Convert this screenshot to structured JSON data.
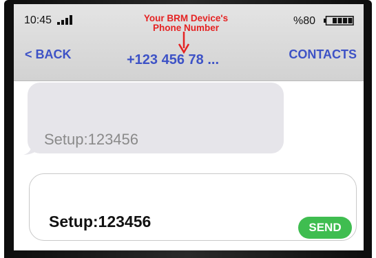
{
  "status_bar": {
    "time": "10:45",
    "battery_percent": "%80",
    "signal_icon": "signal-bars-icon",
    "battery_icon": "battery-icon"
  },
  "annotation": {
    "line1": "Your BRM Device's",
    "line2": "Phone Number",
    "color": "#e52222"
  },
  "nav": {
    "back_label": "< BACK",
    "phone_number": "+123 456 78 ...",
    "contacts_label": "CONTACTS",
    "accent_color": "#3d52c6"
  },
  "conversation": {
    "messages": [
      {
        "text": "Setup:123456"
      }
    ]
  },
  "composer": {
    "value": "Setup:123456",
    "send_label": "SEND",
    "send_color": "#3fbd50"
  }
}
